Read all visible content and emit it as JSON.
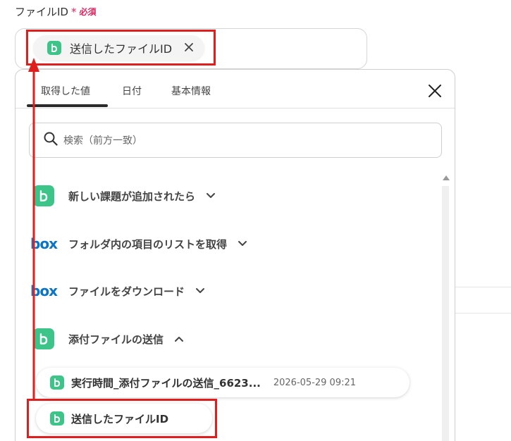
{
  "field": {
    "label": "ファイルID",
    "required_mark": "*",
    "required_text": "必須"
  },
  "selected_chip": {
    "label": "送信したファイルID",
    "icon": "backlog-icon"
  },
  "panel": {
    "tabs": [
      {
        "label": "取得した値",
        "active": true
      },
      {
        "label": "日付",
        "active": false
      },
      {
        "label": "基本情報",
        "active": false
      }
    ],
    "search_placeholder": "検索（前方一致）",
    "groups": [
      {
        "label": "新しい課題が追加されたら",
        "icon": "backlog-icon",
        "expanded": false
      },
      {
        "label": "フォルダ内の項目のリストを取得",
        "icon": "box-logo",
        "expanded": false
      },
      {
        "label": "ファイルをダウンロード",
        "icon": "box-logo",
        "expanded": false
      },
      {
        "label": "添付ファイルの送信",
        "icon": "backlog-icon",
        "expanded": true
      }
    ],
    "values": [
      {
        "label": "実行時間_添付ファイルの送信_6623...",
        "date": "2026-05-29 09:21",
        "icon": "backlog-icon"
      },
      {
        "label": "送信したファイルID",
        "date": "",
        "icon": "backlog-icon"
      }
    ],
    "box_logo_text": "box"
  },
  "colors": {
    "accent_green": "#3dc589",
    "required_red": "#e0245e",
    "highlight_red": "#e01e1e",
    "box_blue": "#0a74c8"
  }
}
